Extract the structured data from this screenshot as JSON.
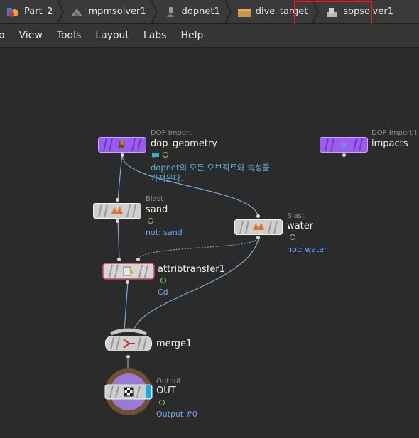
{
  "breadcrumb": {
    "items": [
      {
        "label": "Part_2",
        "icon": "houdini-object-icon"
      },
      {
        "label": "mpmsolver1",
        "icon": "mpm-solver-icon"
      },
      {
        "label": "dopnet1",
        "icon": "dopnet-icon"
      },
      {
        "label": "dive_target",
        "icon": "box-icon"
      },
      {
        "label": "sopsolver1",
        "icon": "sop-solver-icon"
      }
    ]
  },
  "menubar": {
    "items": [
      "o",
      "View",
      "Tools",
      "Layout",
      "Labs",
      "Help"
    ]
  },
  "nodes": {
    "dop_geometry": {
      "type": "DOP Import",
      "name": "dop_geometry",
      "comment": "dopnet의 모든 오브젝트와 속성을\n가져온다."
    },
    "impacts": {
      "type": "DOP Import I",
      "name": "impacts"
    },
    "sand": {
      "type": "Blast",
      "name": "sand",
      "note": "not: sand"
    },
    "water": {
      "type": "Blast",
      "name": "water",
      "note": "not: water"
    },
    "attribtransfer1": {
      "name": "attribtransfer1",
      "note": "Cd"
    },
    "merge1": {
      "name": "merge1"
    },
    "out": {
      "type": "Output",
      "name": "OUT",
      "note": "Output #0"
    }
  },
  "colors": {
    "dop_import": "#9b5cf0",
    "wire": "#7aaad6",
    "output_ring": "#6b5231",
    "output_disc": "#9a7ad6",
    "highlight": "#e02020"
  }
}
